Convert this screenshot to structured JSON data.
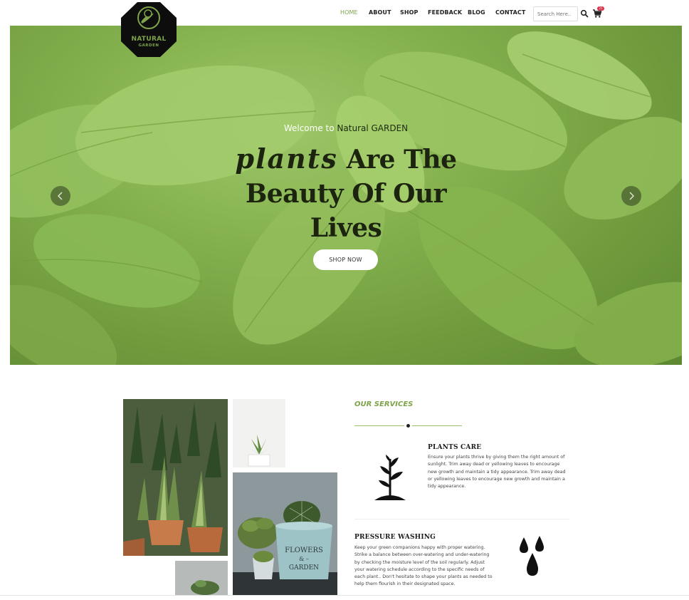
{
  "brand": {
    "logo_line1": "NATURAL",
    "logo_line2": "GARDEN",
    "colors": {
      "accent": "#7ea34a",
      "dark": "#1c240f",
      "badge": "#d9334a"
    }
  },
  "nav": {
    "items": [
      "HOME",
      "ABOUT",
      "SHOP",
      "FEEDBACK",
      "BLOG",
      "CONTACT"
    ],
    "active": "HOME"
  },
  "search": {
    "placeholder": "Search Here.."
  },
  "cart": {
    "count": "21"
  },
  "hero": {
    "welcome_prefix": "Welcome to",
    "welcome_brand": "Natural GARDEN",
    "title_script": "plants",
    "title_line1_rest": "Are The",
    "title_line2": "Beauty Of Our",
    "title_line3": "Lives",
    "cta_label": "SHOP NOW",
    "prev_icon": "chevron-left-icon",
    "next_icon": "chevron-right-icon"
  },
  "services": {
    "kicker": "OUR SERVICES",
    "items": [
      {
        "title": "PLANTS CARE",
        "icon": "sprout-icon",
        "lines": [
          "Ensure your plants thrive by giving them the right amount of",
          "sunlight. Trim away dead or yellowing leaves to encourage",
          "new growth and maintain a tidy appearance. Trim away dead",
          "or yellowing leaves to encourage new growth and maintain a",
          "tidy appearance."
        ]
      },
      {
        "title": "PRESSURE WASHING",
        "icon": "water-drops-icon",
        "lines": [
          "Keep your green companions happy with proper watering.",
          "Strike a balance between over-watering and under-watering",
          "by checking the moisture level of the soil regularly. Adjust",
          "your watering schedule according to the specific needs of",
          "each plant.. Don't hesitate to shape your plants as needed to",
          "help them flourish in their designated space."
        ]
      }
    ]
  },
  "gallery": {
    "pot_text_1": "FLOWERS",
    "pot_text_2": "& –",
    "pot_text_3": "GARDEN"
  }
}
